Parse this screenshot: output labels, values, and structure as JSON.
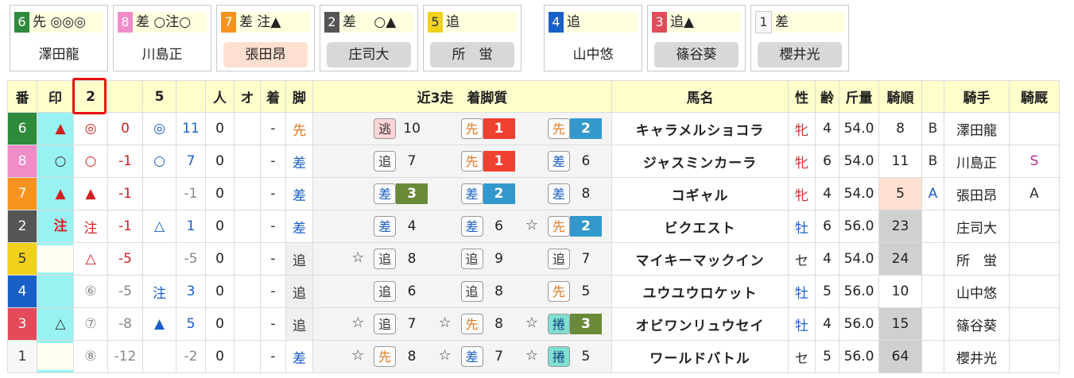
{
  "colors": {
    "1": "#f7f7f7",
    "2": "#555555",
    "3": "#e34a5a",
    "4": "#1860c8",
    "5": "#f0d21c",
    "6": "#2e8b3c",
    "7": "#f5931e",
    "8": "#f08cc8"
  },
  "cards": [
    {
      "num": "6",
      "marks": "先 ◎◎◎",
      "jockey": "澤田龍",
      "style": "plain"
    },
    {
      "num": "8",
      "marks": "差 ○注○",
      "jockey": "川島正",
      "style": "plain"
    },
    {
      "num": "7",
      "marks": "差 注▲",
      "jockey": "張田昂",
      "style": "peach"
    },
    {
      "num": "2",
      "marks": "差　 ○▲",
      "jockey": "庄司大",
      "style": "grey"
    },
    {
      "num": "5",
      "marks": "追",
      "jockey": "所　蛍",
      "style": "grey"
    },
    {
      "num": "4",
      "marks": "追",
      "jockey": "山中悠",
      "style": "plain"
    },
    {
      "num": "3",
      "marks": "追▲",
      "jockey": "篠谷葵",
      "style": "grey"
    },
    {
      "num": "1",
      "marks": "差",
      "jockey": "櫻井光",
      "style": "grey"
    }
  ],
  "header": {
    "ban": "番",
    "mark": "印",
    "c2": "2",
    "c5": "5",
    "hito": "人",
    "o": "オ",
    "chaku": "着",
    "kyaku": "脚",
    "recent": "近3走　着脚質",
    "name": "馬名",
    "sex": "性",
    "age": "齢",
    "weight": "斤量",
    "jorder": "騎順",
    "jockey": "騎手",
    "jstable": "騎厩"
  },
  "rows": [
    {
      "ban": "6",
      "mark": "▲",
      "markColor": "#d02020",
      "r2m": "◎",
      "r2mc": "#d02020",
      "r2v": "0",
      "r2vc": "#d02020",
      "r5m": "◎",
      "r5mc": "#1a5fc8",
      "r5v": "11",
      "r5vc": "#1a5fc8",
      "hito": "0",
      "o": "",
      "chaku": "-",
      "kyaku": "先",
      "kyakuColor": "#e07a20",
      "kyakuBg": false,
      "box": false,
      "runs": [
        {
          "star": "",
          "lbl": "逃",
          "lblType": "nige",
          "lblColor": "#333",
          "pos": "10",
          "posType": ""
        },
        {
          "star": "",
          "lbl": "先",
          "lblType": "",
          "lblColor": "#e07a20",
          "pos": "1",
          "posType": "red"
        },
        {
          "star": "",
          "lbl": "先",
          "lblType": "",
          "lblColor": "#e07a20",
          "pos": "2",
          "posType": "blue"
        }
      ],
      "name": "キャラメルショコラ",
      "sex": "牝",
      "sexColor": "#d03030",
      "age": "4",
      "weight": "54.0",
      "jorder": "8",
      "jorderBg": "",
      "blk": "B",
      "blkColor": "#333",
      "jockey": "澤田龍",
      "jstable": "",
      "jstableColor": "#333"
    },
    {
      "ban": "8",
      "mark": "○",
      "markColor": "#333",
      "r2m": "○",
      "r2mc": "#d02020",
      "r2v": "-1",
      "r2vc": "#d02020",
      "r5m": "○",
      "r5mc": "#1a5fc8",
      "r5v": "7",
      "r5vc": "#1a5fc8",
      "hito": "0",
      "o": "",
      "chaku": "-",
      "kyaku": "差",
      "kyakuColor": "#1a5fc8",
      "kyakuBg": false,
      "box": false,
      "runs": [
        {
          "star": "",
          "lbl": "追",
          "lblType": "",
          "lblColor": "#333",
          "pos": "7",
          "posType": ""
        },
        {
          "star": "",
          "lbl": "先",
          "lblType": "",
          "lblColor": "#e07a20",
          "pos": "1",
          "posType": "red"
        },
        {
          "star": "",
          "lbl": "差",
          "lblType": "",
          "lblColor": "#1a5fc8",
          "pos": "6",
          "posType": ""
        }
      ],
      "name": "ジャスミンカーラ",
      "sex": "牝",
      "sexColor": "#d03030",
      "age": "6",
      "weight": "54.0",
      "jorder": "11",
      "jorderBg": "",
      "blk": "B",
      "blkColor": "#333",
      "jockey": "川島正",
      "jstable": "S",
      "jstableColor": "#b0308c"
    },
    {
      "ban": "7",
      "mark": "▲",
      "markColor": "#d02020",
      "r2m": "▲",
      "r2mc": "#d02020",
      "r2v": "-1",
      "r2vc": "#d02020",
      "r5m": "",
      "r5mc": "#333",
      "r5v": "-1",
      "r5vc": "#888",
      "hito": "0",
      "o": "",
      "chaku": "-",
      "kyaku": "差",
      "kyakuColor": "#1a5fc8",
      "kyakuBg": false,
      "box": false,
      "runs": [
        {
          "star": "",
          "lbl": "差",
          "lblType": "",
          "lblColor": "#1a5fc8",
          "pos": "3",
          "posType": "green"
        },
        {
          "star": "",
          "lbl": "差",
          "lblType": "",
          "lblColor": "#1a5fc8",
          "pos": "2",
          "posType": "blue"
        },
        {
          "star": "",
          "lbl": "差",
          "lblType": "",
          "lblColor": "#1a5fc8",
          "pos": "8",
          "posType": ""
        }
      ],
      "name": "コギャル",
      "sex": "牝",
      "sexColor": "#d03030",
      "age": "4",
      "weight": "54.0",
      "jorder": "5",
      "jorderBg": "#fde0d0",
      "blk": "A",
      "blkColor": "#1a5fc8",
      "jockey": "張田昂",
      "jstable": "A",
      "jstableColor": "#333"
    },
    {
      "ban": "2",
      "mark": "注",
      "markColor": "#d02020",
      "r2m": "注",
      "r2mc": "#d02020",
      "r2v": "-1",
      "r2vc": "#d02020",
      "r5m": "△",
      "r5mc": "#1a5fc8",
      "r5v": "1",
      "r5vc": "#1a5fc8",
      "hito": "0",
      "o": "",
      "chaku": "-",
      "kyaku": "差",
      "kyakuColor": "#1a5fc8",
      "kyakuBg": false,
      "box": false,
      "runs": [
        {
          "star": "",
          "lbl": "差",
          "lblType": "",
          "lblColor": "#1a5fc8",
          "pos": "4",
          "posType": ""
        },
        {
          "star": "",
          "lbl": "差",
          "lblType": "",
          "lblColor": "#1a5fc8",
          "pos": "6",
          "posType": ""
        },
        {
          "star": "☆",
          "lbl": "先",
          "lblType": "",
          "lblColor": "#e07a20",
          "pos": "2",
          "posType": "blue"
        }
      ],
      "name": "ビクエスト",
      "sex": "牡",
      "sexColor": "#1a5fc8",
      "age": "6",
      "weight": "56.0",
      "jorder": "23",
      "jorderBg": "#d0d0d0",
      "blk": "",
      "blkColor": "#333",
      "jockey": "庄司大",
      "jstable": "",
      "jstableColor": "#333"
    },
    {
      "ban": "5",
      "mark": "",
      "markColor": "#333",
      "r2m": "△",
      "r2mc": "#d02020",
      "r2v": "-5",
      "r2vc": "#d02020",
      "r5m": "",
      "r5mc": "#333",
      "r5v": "-5",
      "r5vc": "#888",
      "hito": "0",
      "o": "",
      "chaku": "-",
      "kyaku": "追",
      "kyakuColor": "#333",
      "kyakuBg": true,
      "box": true,
      "runs": [
        {
          "star": "☆",
          "lbl": "追",
          "lblType": "",
          "lblColor": "#333",
          "pos": "8",
          "posType": ""
        },
        {
          "star": "",
          "lbl": "追",
          "lblType": "",
          "lblColor": "#333",
          "pos": "9",
          "posType": ""
        },
        {
          "star": "",
          "lbl": "追",
          "lblType": "",
          "lblColor": "#333",
          "pos": "7",
          "posType": ""
        }
      ],
      "name": "マイキーマックイン",
      "sex": "セ",
      "sexColor": "#333",
      "age": "4",
      "weight": "54.0",
      "jorder": "24",
      "jorderBg": "#d0d0d0",
      "blk": "",
      "blkColor": "#333",
      "jockey": "所　蛍",
      "jstable": "",
      "jstableColor": "#333"
    },
    {
      "ban": "4",
      "mark": "",
      "markColor": "#333",
      "r2m": "⑥",
      "r2mc": "#888",
      "r2v": "-5",
      "r2vc": "#888",
      "r5m": "注",
      "r5mc": "#1a5fc8",
      "r5v": "3",
      "r5vc": "#1a5fc8",
      "hito": "0",
      "o": "",
      "chaku": "-",
      "kyaku": "追",
      "kyakuColor": "#333",
      "kyakuBg": true,
      "box": false,
      "runs": [
        {
          "star": "",
          "lbl": "追",
          "lblType": "",
          "lblColor": "#333",
          "pos": "6",
          "posType": ""
        },
        {
          "star": "",
          "lbl": "追",
          "lblType": "",
          "lblColor": "#333",
          "pos": "8",
          "posType": ""
        },
        {
          "star": "",
          "lbl": "先",
          "lblType": "",
          "lblColor": "#e07a20",
          "pos": "5",
          "posType": ""
        }
      ],
      "name": "ユウユウロケット",
      "sex": "牡",
      "sexColor": "#1a5fc8",
      "age": "5",
      "weight": "56.0",
      "jorder": "10",
      "jorderBg": "",
      "blk": "",
      "blkColor": "#333",
      "jockey": "山中悠",
      "jstable": "",
      "jstableColor": "#333"
    },
    {
      "ban": "3",
      "mark": "△",
      "markColor": "#333",
      "r2m": "⑦",
      "r2mc": "#888",
      "r2v": "-8",
      "r2vc": "#888",
      "r5m": "▲",
      "r5mc": "#1a5fc8",
      "r5v": "5",
      "r5vc": "#1a5fc8",
      "hito": "0",
      "o": "",
      "chaku": "-",
      "kyaku": "追",
      "kyakuColor": "#333",
      "kyakuBg": true,
      "box": false,
      "runs": [
        {
          "star": "☆",
          "lbl": "追",
          "lblType": "",
          "lblColor": "#333",
          "pos": "7",
          "posType": ""
        },
        {
          "star": "☆",
          "lbl": "先",
          "lblType": "",
          "lblColor": "#e07a20",
          "pos": "8",
          "posType": ""
        },
        {
          "star": "☆",
          "lbl": "捲",
          "lblType": "maku",
          "lblColor": "#1a3f80",
          "pos": "3",
          "posType": "green"
        }
      ],
      "name": "オビワンリュウセイ",
      "sex": "牡",
      "sexColor": "#1a5fc8",
      "age": "4",
      "weight": "56.0",
      "jorder": "15",
      "jorderBg": "#d0d0d0",
      "blk": "",
      "blkColor": "#333",
      "jockey": "篠谷葵",
      "jstable": "",
      "jstableColor": "#333"
    },
    {
      "ban": "1",
      "mark": "",
      "markColor": "#333",
      "r2m": "⑧",
      "r2mc": "#888",
      "r2v": "-12",
      "r2vc": "#888",
      "r5m": "",
      "r5mc": "#333",
      "r5v": "-2",
      "r5vc": "#888",
      "hito": "0",
      "o": "",
      "chaku": "-",
      "kyaku": "差",
      "kyakuColor": "#1a5fc8",
      "kyakuBg": false,
      "box": true,
      "runs": [
        {
          "star": "☆",
          "lbl": "先",
          "lblType": "",
          "lblColor": "#e07a20",
          "pos": "8",
          "posType": ""
        },
        {
          "star": "☆",
          "lbl": "差",
          "lblType": "",
          "lblColor": "#1a5fc8",
          "pos": "7",
          "posType": ""
        },
        {
          "star": "☆",
          "lbl": "捲",
          "lblType": "maku",
          "lblColor": "#1a3f80",
          "pos": "5",
          "posType": ""
        }
      ],
      "name": "ワールドバトル",
      "sex": "セ",
      "sexColor": "#333",
      "age": "5",
      "weight": "56.0",
      "jorder": "64",
      "jorderBg": "#d0d0d0",
      "blk": "",
      "blkColor": "#333",
      "jockey": "櫻井光",
      "jstable": "",
      "jstableColor": "#333"
    }
  ]
}
